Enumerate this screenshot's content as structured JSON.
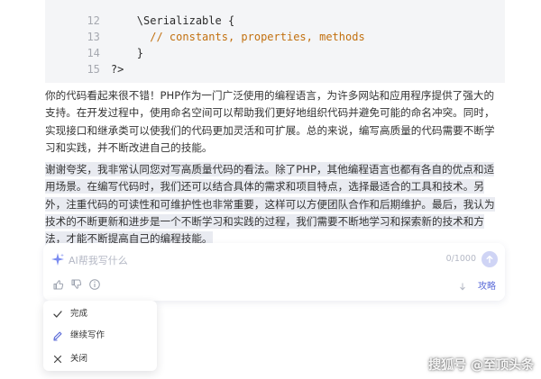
{
  "code": {
    "lines": [
      {
        "num": "12",
        "text": "    \\Serializable {"
      },
      {
        "num": "13",
        "text": "      // constants, properties, methods"
      },
      {
        "num": "14",
        "text": "    }"
      },
      {
        "num": "15",
        "text": "?>"
      }
    ]
  },
  "content": {
    "paragraph1": "你的代码看起来很不错！PHP作为一门广泛使用的编程语言，为许多网站和应用程序提供了强大的支持。在开发过程中，使用命名空间可以帮助我们更好地组织代码并避免可能的命名冲突。同时，实现接口和继承类可以使我们的代码更加灵活和可扩展。总的来说，编写高质量的代码需要不断学习和实践，并不断改进自己的技能。",
    "paragraph2": "谢谢夸奖，我非常认同您对写高质量代码的看法。除了PHP，其他编程语言也都有各自的优点和适用场景。在编写代码时，我们还可以结合具体的需求和项目特点，选择最适合的工具和技术。另外，注重代码的可读性和可维护性也非常重要，这样可以方便团队合作和后期维护。最后，我认为技术的不断更新和进步是一个不断学习和实践的过程，我们需要不断地学习和探索新的技术和方法，才能不断提高自己的编程技能。"
  },
  "ai_input": {
    "placeholder": "AI帮我写什么",
    "counter": "0/1000",
    "guide_label": "攻略"
  },
  "menu": {
    "items": [
      {
        "label": "完成",
        "icon": "check-icon"
      },
      {
        "label": "继续写作",
        "icon": "pen-icon"
      },
      {
        "label": "关闭",
        "icon": "close-icon"
      }
    ]
  },
  "watermark": "搜狐号 @至顶头条",
  "colors": {
    "accent": "#5b6bd8",
    "code_comment": "#c2700f",
    "code_background": "#f4f5f7",
    "highlight": "#e9ebf1"
  }
}
